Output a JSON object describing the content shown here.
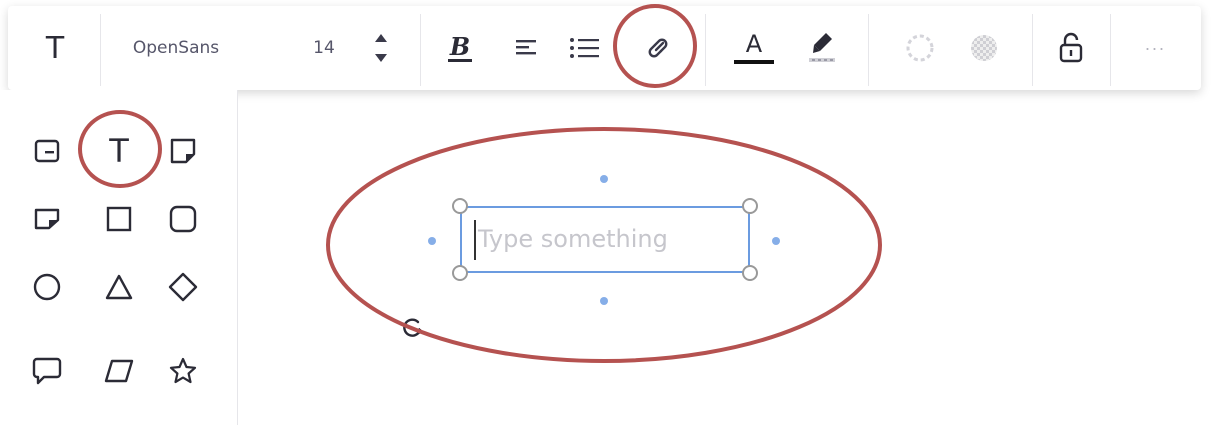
{
  "toolbar": {
    "text_tool_glyph": "T",
    "font_family": "OpenSans",
    "font_size": "14",
    "bold_glyph": "B",
    "text_color_glyph": "A",
    "more_glyph": "···",
    "text_color": "#111111"
  },
  "shapes_panel": {
    "text_shape_glyph": "T",
    "items": [
      {
        "name": "card-icon"
      },
      {
        "name": "text-icon"
      },
      {
        "name": "sticky-note-icon"
      },
      {
        "name": "sticky-note-alt-icon"
      },
      {
        "name": "square-icon"
      },
      {
        "name": "rounded-square-icon"
      },
      {
        "name": "circle-icon"
      },
      {
        "name": "triangle-icon"
      },
      {
        "name": "diamond-icon"
      },
      {
        "name": "speech-bubble-icon"
      },
      {
        "name": "parallelogram-icon"
      },
      {
        "name": "star-icon"
      }
    ]
  },
  "canvas": {
    "text_placeholder": "Type something",
    "selection_color": "#6b9be0",
    "highlight_color": "#b55250"
  }
}
